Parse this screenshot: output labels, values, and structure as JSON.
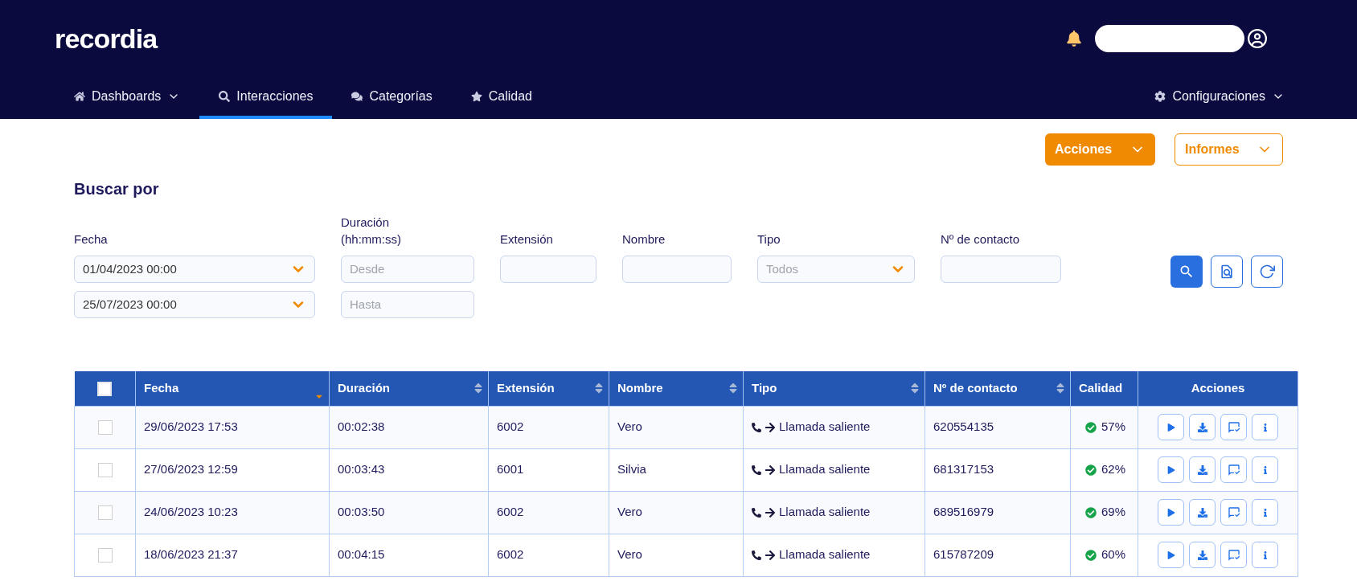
{
  "header": {
    "logo": "recordia"
  },
  "nav": {
    "items": [
      {
        "label": "Dashboards",
        "selected": false
      },
      {
        "label": "Interacciones",
        "selected": true
      },
      {
        "label": "Categorías",
        "selected": false
      },
      {
        "label": "Calidad",
        "selected": false
      }
    ],
    "right_item": {
      "label": "Configuraciones"
    }
  },
  "toolbar": {
    "buttons": [
      {
        "label": "Acciones",
        "kind": "filled"
      },
      {
        "label": "Informes",
        "kind": "outline"
      }
    ]
  },
  "search": {
    "title": "Buscar por",
    "fields": [
      {
        "label": "Fecha",
        "kind": "date",
        "inputs": [
          {
            "value": "01/04/2023 00:00"
          },
          {
            "value": "25/07/2023 00:00"
          }
        ]
      },
      {
        "label": "Duración (hh:mm:ss)",
        "kind": "range",
        "inputs": [
          {
            "placeholder": "Desde"
          },
          {
            "placeholder": "Hasta"
          }
        ]
      },
      {
        "label": "Extensión",
        "kind": "text"
      },
      {
        "label": "Nombre",
        "kind": "text"
      },
      {
        "label": "Tipo",
        "kind": "select",
        "inputs": [
          {
            "placeholder": "Todos"
          }
        ]
      },
      {
        "label": "Nº de contacto",
        "kind": "text"
      }
    ]
  },
  "table": {
    "select_all_checked": false,
    "columns": [
      {
        "label": "Fecha",
        "sorted": true
      },
      {
        "label": "Duración",
        "sorted": false
      },
      {
        "label": "Extensión",
        "sorted": false
      },
      {
        "label": "Nombre",
        "sorted": false
      },
      {
        "label": "Tipo",
        "sorted": false
      },
      {
        "label": "Nº de contacto",
        "sorted": false
      },
      {
        "label": "Calidad"
      },
      {
        "label": "Acciones"
      }
    ],
    "rows": [
      {
        "checked": false,
        "fecha": "29/06/2023 17:53",
        "duracion": "00:02:38",
        "extension": "6002",
        "nombre": "Vero",
        "tipo": "Llamada saliente",
        "contacto": "620554135",
        "calidad": "57%"
      },
      {
        "checked": false,
        "fecha": "27/06/2023 12:59",
        "duracion": "00:03:43",
        "extension": "6001",
        "nombre": "Silvia",
        "tipo": "Llamada saliente",
        "contacto": "681317153",
        "calidad": "62%"
      },
      {
        "checked": false,
        "fecha": "24/06/2023 10:23",
        "duracion": "00:03:50",
        "extension": "6002",
        "nombre": "Vero",
        "tipo": "Llamada saliente",
        "contacto": "689516979",
        "calidad": "69%"
      },
      {
        "checked": false,
        "fecha": "18/06/2023 21:37",
        "duracion": "00:04:15",
        "extension": "6002",
        "nombre": "Vero",
        "tipo": "Llamada saliente",
        "contacto": "615787209",
        "calidad": "60%"
      }
    ]
  }
}
